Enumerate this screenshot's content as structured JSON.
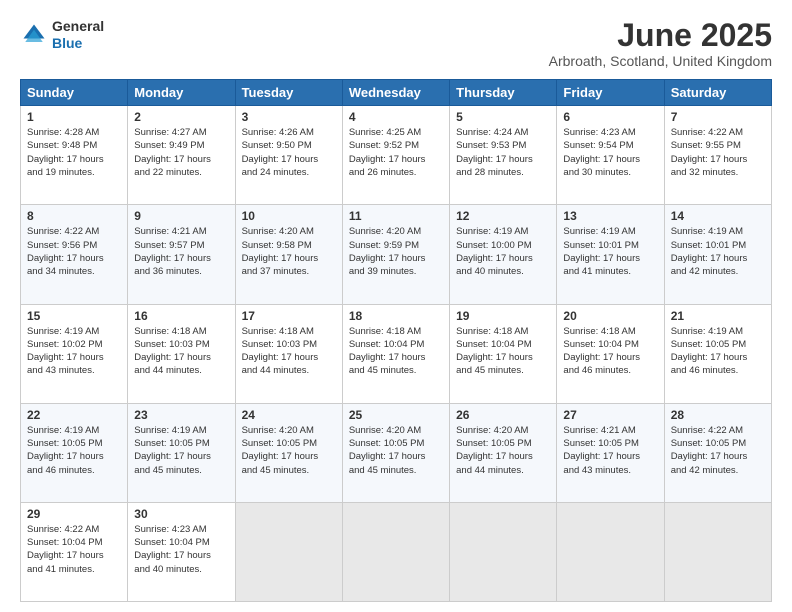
{
  "header": {
    "logo_line1": "General",
    "logo_line2": "Blue",
    "month_title": "June 2025",
    "location": "Arbroath, Scotland, United Kingdom"
  },
  "weekdays": [
    "Sunday",
    "Monday",
    "Tuesday",
    "Wednesday",
    "Thursday",
    "Friday",
    "Saturday"
  ],
  "weeks": [
    [
      {
        "day": "1",
        "sunrise": "4:28 AM",
        "sunset": "9:48 PM",
        "daylight": "17 hours and 19 minutes."
      },
      {
        "day": "2",
        "sunrise": "4:27 AM",
        "sunset": "9:49 PM",
        "daylight": "17 hours and 22 minutes."
      },
      {
        "day": "3",
        "sunrise": "4:26 AM",
        "sunset": "9:50 PM",
        "daylight": "17 hours and 24 minutes."
      },
      {
        "day": "4",
        "sunrise": "4:25 AM",
        "sunset": "9:52 PM",
        "daylight": "17 hours and 26 minutes."
      },
      {
        "day": "5",
        "sunrise": "4:24 AM",
        "sunset": "9:53 PM",
        "daylight": "17 hours and 28 minutes."
      },
      {
        "day": "6",
        "sunrise": "4:23 AM",
        "sunset": "9:54 PM",
        "daylight": "17 hours and 30 minutes."
      },
      {
        "day": "7",
        "sunrise": "4:22 AM",
        "sunset": "9:55 PM",
        "daylight": "17 hours and 32 minutes."
      }
    ],
    [
      {
        "day": "8",
        "sunrise": "4:22 AM",
        "sunset": "9:56 PM",
        "daylight": "17 hours and 34 minutes."
      },
      {
        "day": "9",
        "sunrise": "4:21 AM",
        "sunset": "9:57 PM",
        "daylight": "17 hours and 36 minutes."
      },
      {
        "day": "10",
        "sunrise": "4:20 AM",
        "sunset": "9:58 PM",
        "daylight": "17 hours and 37 minutes."
      },
      {
        "day": "11",
        "sunrise": "4:20 AM",
        "sunset": "9:59 PM",
        "daylight": "17 hours and 39 minutes."
      },
      {
        "day": "12",
        "sunrise": "4:19 AM",
        "sunset": "10:00 PM",
        "daylight": "17 hours and 40 minutes."
      },
      {
        "day": "13",
        "sunrise": "4:19 AM",
        "sunset": "10:01 PM",
        "daylight": "17 hours and 41 minutes."
      },
      {
        "day": "14",
        "sunrise": "4:19 AM",
        "sunset": "10:01 PM",
        "daylight": "17 hours and 42 minutes."
      }
    ],
    [
      {
        "day": "15",
        "sunrise": "4:19 AM",
        "sunset": "10:02 PM",
        "daylight": "17 hours and 43 minutes."
      },
      {
        "day": "16",
        "sunrise": "4:18 AM",
        "sunset": "10:03 PM",
        "daylight": "17 hours and 44 minutes."
      },
      {
        "day": "17",
        "sunrise": "4:18 AM",
        "sunset": "10:03 PM",
        "daylight": "17 hours and 44 minutes."
      },
      {
        "day": "18",
        "sunrise": "4:18 AM",
        "sunset": "10:04 PM",
        "daylight": "17 hours and 45 minutes."
      },
      {
        "day": "19",
        "sunrise": "4:18 AM",
        "sunset": "10:04 PM",
        "daylight": "17 hours and 45 minutes."
      },
      {
        "day": "20",
        "sunrise": "4:18 AM",
        "sunset": "10:04 PM",
        "daylight": "17 hours and 46 minutes."
      },
      {
        "day": "21",
        "sunrise": "4:19 AM",
        "sunset": "10:05 PM",
        "daylight": "17 hours and 46 minutes."
      }
    ],
    [
      {
        "day": "22",
        "sunrise": "4:19 AM",
        "sunset": "10:05 PM",
        "daylight": "17 hours and 46 minutes."
      },
      {
        "day": "23",
        "sunrise": "4:19 AM",
        "sunset": "10:05 PM",
        "daylight": "17 hours and 45 minutes."
      },
      {
        "day": "24",
        "sunrise": "4:20 AM",
        "sunset": "10:05 PM",
        "daylight": "17 hours and 45 minutes."
      },
      {
        "day": "25",
        "sunrise": "4:20 AM",
        "sunset": "10:05 PM",
        "daylight": "17 hours and 45 minutes."
      },
      {
        "day": "26",
        "sunrise": "4:20 AM",
        "sunset": "10:05 PM",
        "daylight": "17 hours and 44 minutes."
      },
      {
        "day": "27",
        "sunrise": "4:21 AM",
        "sunset": "10:05 PM",
        "daylight": "17 hours and 43 minutes."
      },
      {
        "day": "28",
        "sunrise": "4:22 AM",
        "sunset": "10:05 PM",
        "daylight": "17 hours and 42 minutes."
      }
    ],
    [
      {
        "day": "29",
        "sunrise": "4:22 AM",
        "sunset": "10:04 PM",
        "daylight": "17 hours and 41 minutes."
      },
      {
        "day": "30",
        "sunrise": "4:23 AM",
        "sunset": "10:04 PM",
        "daylight": "17 hours and 40 minutes."
      },
      null,
      null,
      null,
      null,
      null
    ]
  ]
}
